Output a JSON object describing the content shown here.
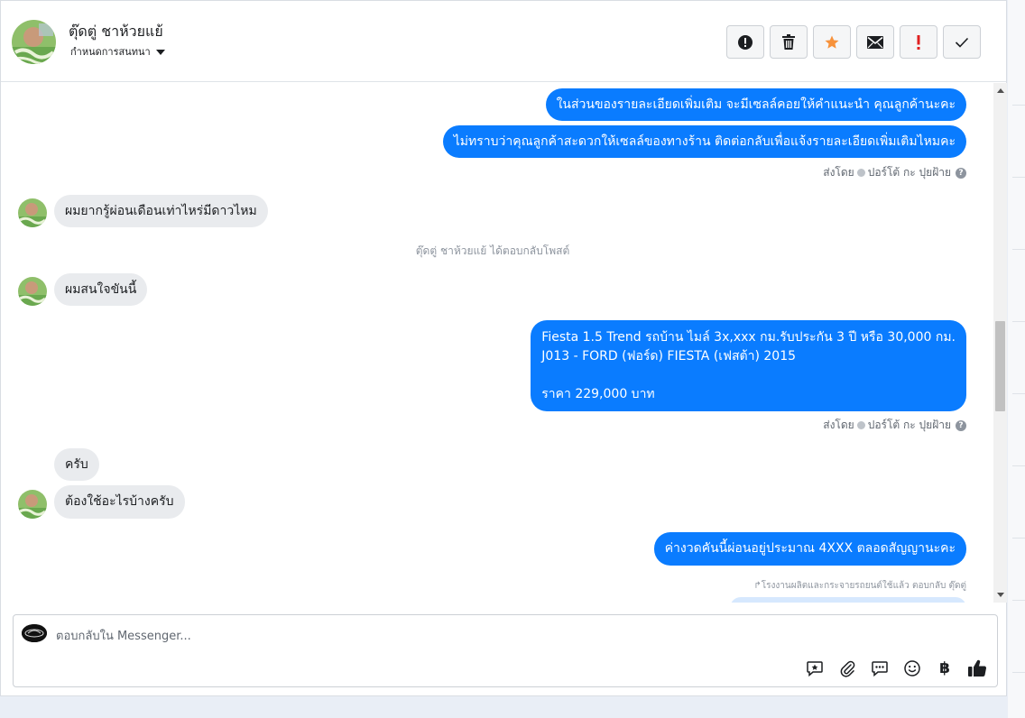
{
  "header": {
    "contact_name": "ตุ๊ดตู่ ชาห้วยแย้",
    "assign_label": "กำหนดการสนทนา"
  },
  "toolbar": {
    "spam_icon": "exclamation-circle-icon",
    "delete_icon": "trash-icon",
    "star_icon": "star-icon",
    "unread_icon": "envelope-icon",
    "follow_up_icon": "exclamation-icon",
    "done_icon": "checkmark-icon",
    "star_color": "#f7923b",
    "follow_up_color": "#e02020"
  },
  "messages": [
    {
      "dir": "out",
      "text": "ในส่วนของรายละเอียดเพิ่มเติม จะมีเซลล์คอยให้คำแนะนำ คุณลูกค้านะคะ"
    },
    {
      "dir": "out",
      "text": "ไม่ทราบว่าคุณลูกค้าสะดวกให้เซลล์ของทางร้าน ติดต่อกลับเพื่อแจ้งรายละเอียดเพิ่มเติมไหมคะ"
    },
    {
      "dir": "in",
      "text": "ผมยากรู้ผ่อนเดือนเท่าไหร่มีดาวไหม"
    },
    {
      "dir": "in",
      "text": "ผมสนใจขันนี้"
    },
    {
      "dir": "out",
      "lines": [
        "Fiesta 1.5 Trend รถบ้าน ไมล์ 3x,xxx กม.รับประกัน 3 ปี หรือ 30,000 กม.",
        "J013 - FORD (ฟอร์ด) FIESTA (เฟสต้า) 2015",
        "",
        "ราคา 229,000 บาท"
      ]
    },
    {
      "dir": "in",
      "text": "ครับ"
    },
    {
      "dir": "in",
      "text": "ต้องใช้อะไรบ้างครับ"
    },
    {
      "dir": "out",
      "text": "ค่างวดคันนี้ผ่อนอยู่ประมาณ 4XXX  ตลอดสัญญานะคะ"
    }
  ],
  "sent_by": {
    "prefix": "ส่งโดย",
    "sender": "ปอร์โต้ กะ ปุยฝ้าย",
    "help": "?"
  },
  "system_note": "ตุ๊ดตู่ ชาห้วยแย้ ได้ตอบกลับโพสต์",
  "reply_note": "↱โรงงานผลิตและกระจายรถยนต์ใช้แล้ว ตอบกลับ ตุ๊ดตู่",
  "composer": {
    "placeholder": "ตอบกลับใน Messenger...",
    "currency_symbol": "฿"
  },
  "colors": {
    "outgoing_bubble": "#0a7cff",
    "incoming_bubble": "#e9ebee",
    "like_icon": "#1c1e21"
  }
}
